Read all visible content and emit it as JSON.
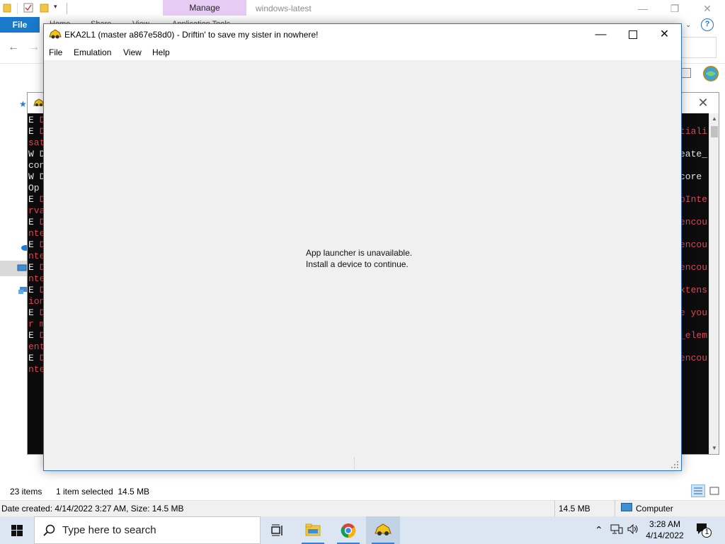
{
  "explorer": {
    "title": "windows-latest",
    "manage_tab": "Manage",
    "file_tab": "File",
    "ribbon_tabs": [
      "Home",
      "Share",
      "View",
      "Application Tools"
    ],
    "help": "?",
    "status": {
      "item_count": "23 items",
      "selection": "1 item selected  14.5 MB"
    },
    "details": {
      "info": "Date created: 4/14/2022 3:27 AM, Size: 14.5 MB",
      "size": "14.5 MB",
      "location": "Computer"
    }
  },
  "console": {
    "lines": [
      {
        "prefix": "E ",
        "red": "D",
        "rest": ""
      },
      {
        "prefix": "E ",
        "red": "D",
        "rest": ""
      },
      {
        "prefix": "",
        "red": "sat",
        "rest": ""
      },
      {
        "prefix": "W D",
        "red": "",
        "rest": ""
      },
      {
        "prefix": "con",
        "red": "",
        "rest": ""
      },
      {
        "prefix": "W D",
        "red": "",
        "rest": ""
      },
      {
        "prefix": " Op",
        "red": "",
        "rest": ""
      },
      {
        "prefix": "E ",
        "red": "D",
        "rest": ""
      },
      {
        "prefix": "",
        "red": "rva",
        "rest": ""
      },
      {
        "prefix": "E ",
        "red": "D",
        "rest": ""
      },
      {
        "prefix": "",
        "red": "nte",
        "rest": ""
      },
      {
        "prefix": "E ",
        "red": "D",
        "rest": ""
      },
      {
        "prefix": "",
        "red": "nte",
        "rest": ""
      },
      {
        "prefix": "E ",
        "red": "D",
        "rest": ""
      },
      {
        "prefix": "",
        "red": "nte",
        "rest": ""
      },
      {
        "prefix": "E ",
        "red": "D",
        "rest": ""
      },
      {
        "prefix": "",
        "red": "ion",
        "rest": ""
      },
      {
        "prefix": "E ",
        "red": "D",
        "rest": ""
      },
      {
        "prefix": "",
        "red": "r m",
        "rest": ""
      },
      {
        "prefix": "E ",
        "red": "D",
        "rest": ""
      },
      {
        "prefix": "",
        "red": "ent",
        "rest": ""
      },
      {
        "prefix": "E ",
        "red": "D",
        "rest": ""
      },
      {
        "prefix": "",
        "red": "nte",
        "rest": ""
      }
    ],
    "right_fragments": [
      {
        "text": "tiali",
        "color": "#e0455a"
      },
      {
        "text": "eate_",
        "color": "#e8e8e8"
      },
      {
        "text": " core",
        "color": "#e8e8e8"
      },
      {
        "text": "pInte",
        "color": "#e0455a"
      },
      {
        "text": "encou",
        "color": "#e0455a"
      },
      {
        "text": "encou",
        "color": "#e0455a"
      },
      {
        "text": "encou",
        "color": "#e0455a"
      },
      {
        "text": "xtens",
        "color": "#e0455a"
      },
      {
        "text": "e you",
        "color": "#e0455a"
      },
      {
        "text": "_elem",
        "color": "#e0455a"
      },
      {
        "text": "encou",
        "color": "#e0455a"
      }
    ]
  },
  "eka": {
    "title": "EKA2L1 (master a867e58d0) - Driftin' to save my sister in nowhere!",
    "menu": [
      "File",
      "Emulation",
      "View",
      "Help"
    ],
    "message_line1": "App launcher is unavailable.",
    "message_line2": "Install a device to continue.",
    "controls": {
      "minimize": "—",
      "maximize": "☐",
      "close": "✕"
    }
  },
  "taskbar": {
    "search_placeholder": "Type here to search",
    "apps": [
      "task-view-icon",
      "file-explorer-icon",
      "chrome-icon",
      "eka2l1-icon"
    ],
    "active_app": "eka2l1-icon",
    "time": "3:28 AM",
    "date": "4/14/2022",
    "notification_count": "1"
  },
  "colors": {
    "accent": "#1979ca",
    "manage_tab": "#e6ccf5",
    "console_bg": "#0c0c0c",
    "console_red": "#e0455a",
    "taskbar": "#dbe6f2"
  }
}
